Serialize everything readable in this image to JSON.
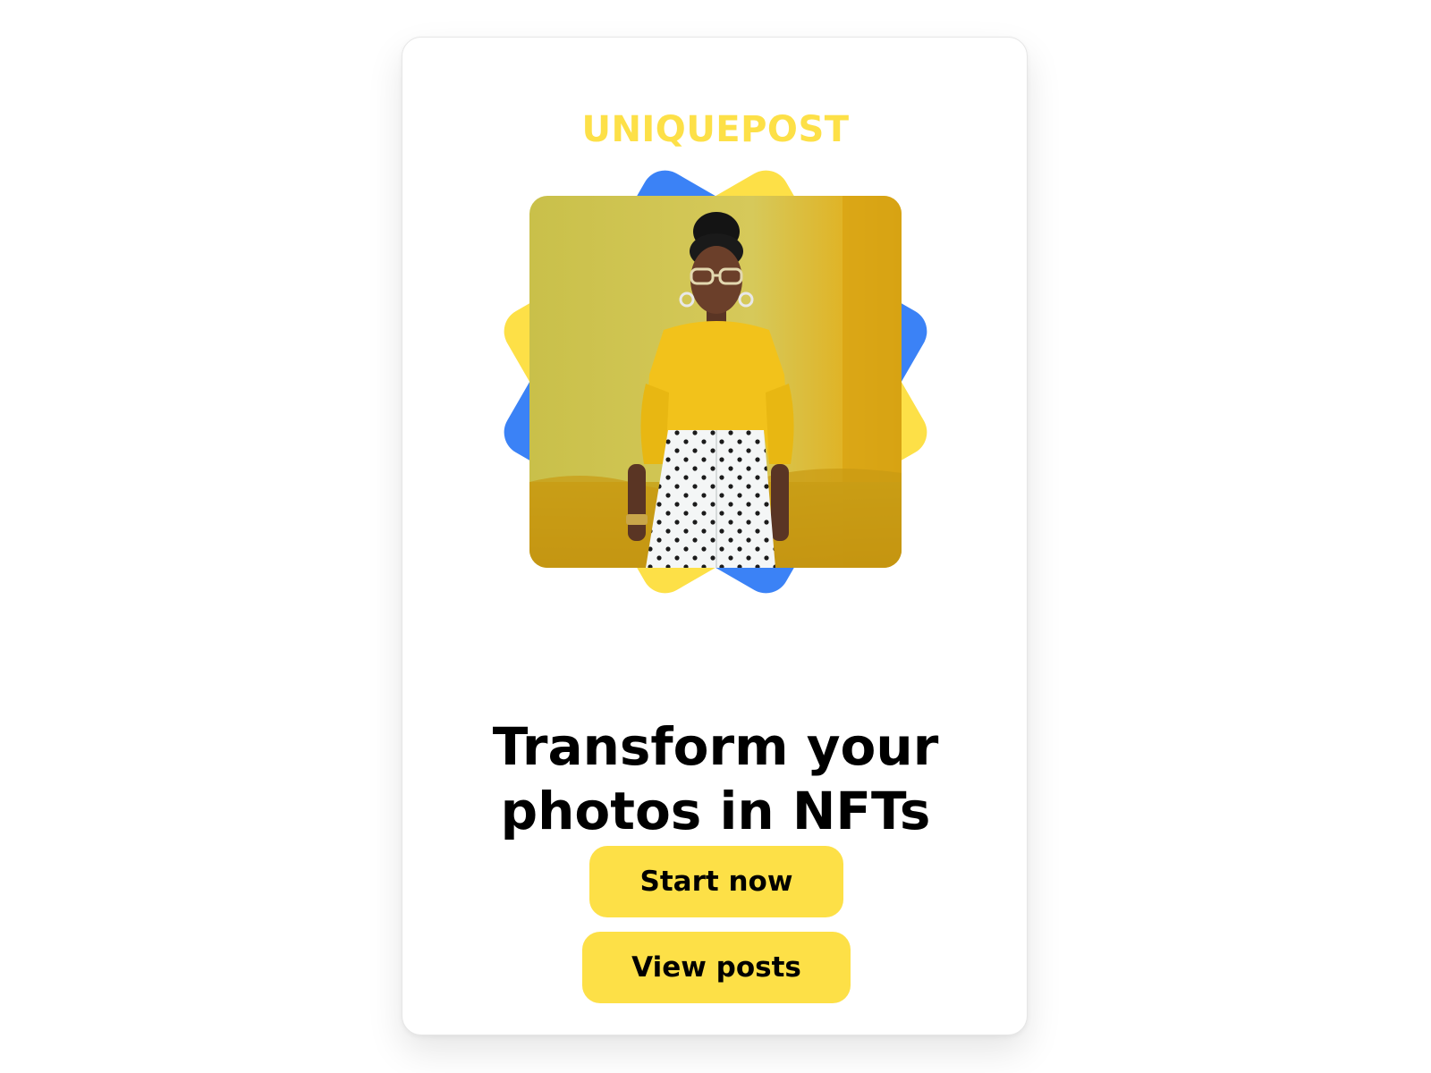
{
  "brand": {
    "name": "UNIQUEPOST"
  },
  "hero": {
    "image_alt": "Woman in yellow sweater and polka-dot skirt against a yellow wall",
    "shape_colors": [
      "#3b82f6",
      "#fde047"
    ]
  },
  "headline": {
    "line1": "Transform your",
    "line2": "photos in NFTs"
  },
  "actions": {
    "start_label": "Start now",
    "view_label": "View posts"
  },
  "colors": {
    "accent": "#fde047",
    "secondary": "#3b82f6",
    "text": "#000000",
    "background": "#ffffff"
  }
}
